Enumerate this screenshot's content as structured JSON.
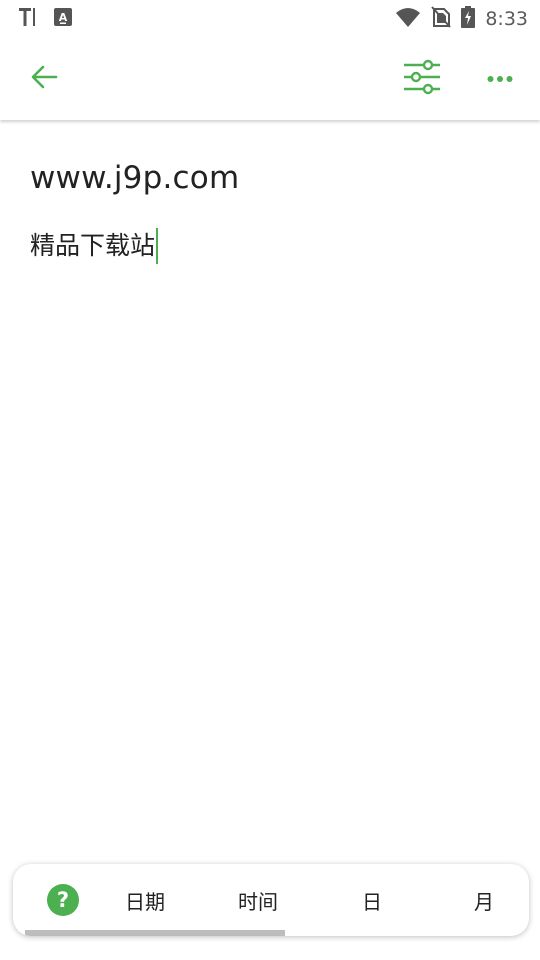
{
  "status_bar": {
    "time": "8:33",
    "icons": [
      "text-notification-icon",
      "keyboard-a-icon",
      "wifi-icon",
      "no-sim-icon",
      "battery-charging-icon"
    ]
  },
  "toolbar": {
    "back_icon": "arrow-left-icon",
    "format_icon": "sliders-icon",
    "more_icon": "more-dots-icon",
    "accent_color": "#4caf50"
  },
  "note": {
    "title": "www.j9p.com",
    "body": "精品下载站"
  },
  "insert_bar": {
    "help_label": "?",
    "items": [
      "日期",
      "时间",
      "日",
      "月"
    ],
    "scroll_fraction": 0.52
  }
}
